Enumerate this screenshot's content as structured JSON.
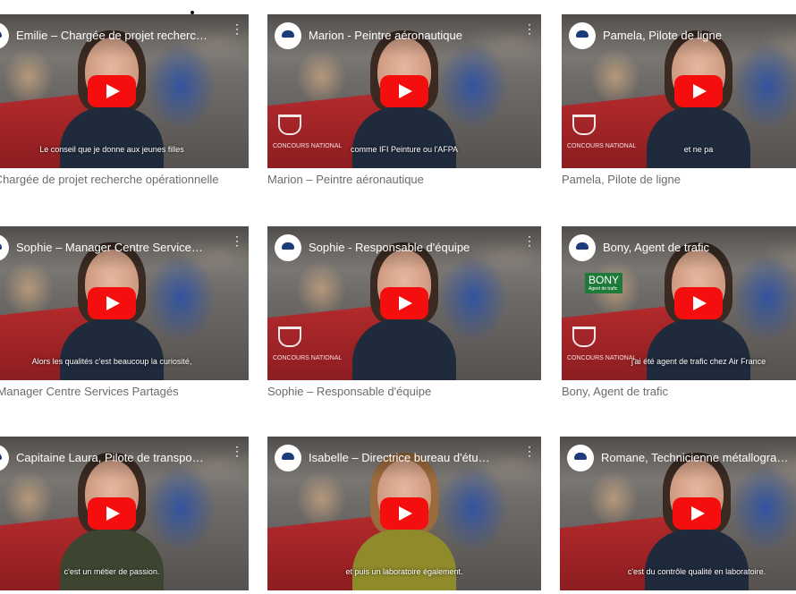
{
  "videos": [
    {
      "title": "Emilie – Chargée de projet recherc…",
      "caption": "e – Chargée de projet recherche opérationnelle",
      "subtitle": "Le conseil que je donne aux jeunes filles",
      "badge": "",
      "badge_sub": "",
      "concours": ""
    },
    {
      "title": "Marion - Peintre aéronautique",
      "caption": "Marion – Peintre aéronautique",
      "subtitle": "comme IFI Peinture ou l'AFPA",
      "badge": "",
      "badge_sub": "",
      "concours": "CONCOURS NATIONAL"
    },
    {
      "title": "Pamela, Pilote de ligne",
      "caption": "Pamela, Pilote de ligne",
      "subtitle": "et ne pa",
      "badge": "",
      "badge_sub": "",
      "concours": "CONCOURS NATIONAL"
    },
    {
      "title": "Sophie – Manager Centre Service…",
      "caption": "ie – Manager Centre Services Partagés",
      "subtitle": "Alors les qualités c'est beaucoup la curiosité,",
      "badge": "",
      "badge_sub": "",
      "concours": ""
    },
    {
      "title": "Sophie - Responsable d'équipe",
      "caption": "Sophie – Responsable d'équipe",
      "subtitle": "",
      "badge": "",
      "badge_sub": "",
      "concours": "CONCOURS NATIONAL"
    },
    {
      "title": "Bony, Agent de trafic",
      "caption": "Bony, Agent de trafic",
      "subtitle": "j'ai été agent de trafic chez Air France",
      "badge": "BONY",
      "badge_sub": "Agent de trafic",
      "concours": "CONCOURS NATIONAL"
    },
    {
      "title": "Capitaine Laura, Pilote de transpo…",
      "caption": "",
      "subtitle": "c'est un métier de passion.",
      "badge": "",
      "badge_sub": "",
      "concours": ""
    },
    {
      "title": "Isabelle – Directrice bureau d'étu…",
      "caption": "",
      "subtitle": "et puis un laboratoire également.",
      "badge": "",
      "badge_sub": "",
      "concours": ""
    },
    {
      "title": "Romane, Technicienne métallogra…",
      "caption": "",
      "subtitle": "c'est du contrôle qualité en laboratoire.",
      "badge": "",
      "badge_sub": "",
      "concours": ""
    }
  ],
  "colors": {
    "play": "#f40e0e",
    "caption": "#6b6b6b",
    "panel": "#b32a2c"
  },
  "icons": {
    "play": "youtube-play-icon",
    "menu": "more-vert-icon",
    "logo": "channel-logo-icon",
    "trophy": "trophy-icon"
  }
}
